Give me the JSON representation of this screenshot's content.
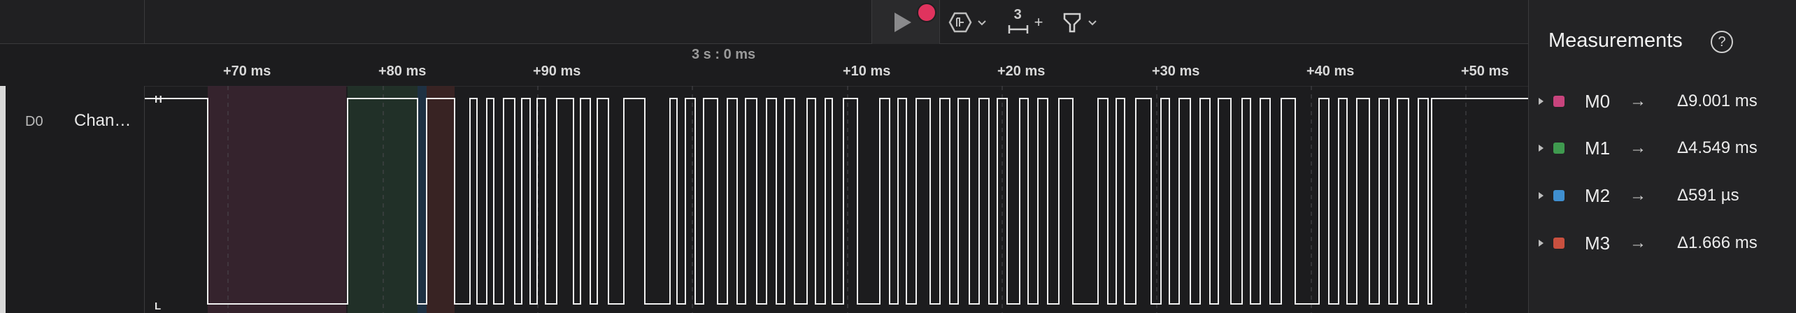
{
  "toolbar": {
    "record_color": "#e0335e",
    "trigger_icon": "hexagon-trigger-icon",
    "timing_marker_number": "3",
    "timing_marker_plus": "+",
    "filter_icon": "funnel-icon"
  },
  "ruler": {
    "center_label": "3 s : 0 ms",
    "ticks": [
      "+70 ms",
      "+80 ms",
      "+90 ms",
      "+10 ms",
      "+20 ms",
      "+30 ms",
      "+40 ms",
      "+50 ms"
    ]
  },
  "channel": {
    "number": "D0",
    "name": "Chan…",
    "high_label": "H",
    "low_label": "L"
  },
  "measurements": {
    "title": "Measurements",
    "help_symbol": "?",
    "rows": [
      {
        "name": "M0",
        "value": "Δ9.001 ms",
        "color": "#c8447d"
      },
      {
        "name": "M1",
        "value": "Δ4.549 ms",
        "color": "#3f9a4f"
      },
      {
        "name": "M2",
        "value": "Δ591 µs",
        "color": "#3f8fd0"
      },
      {
        "name": "M3",
        "value": "Δ1.666 ms",
        "color": "#c9503f"
      }
    ]
  }
}
